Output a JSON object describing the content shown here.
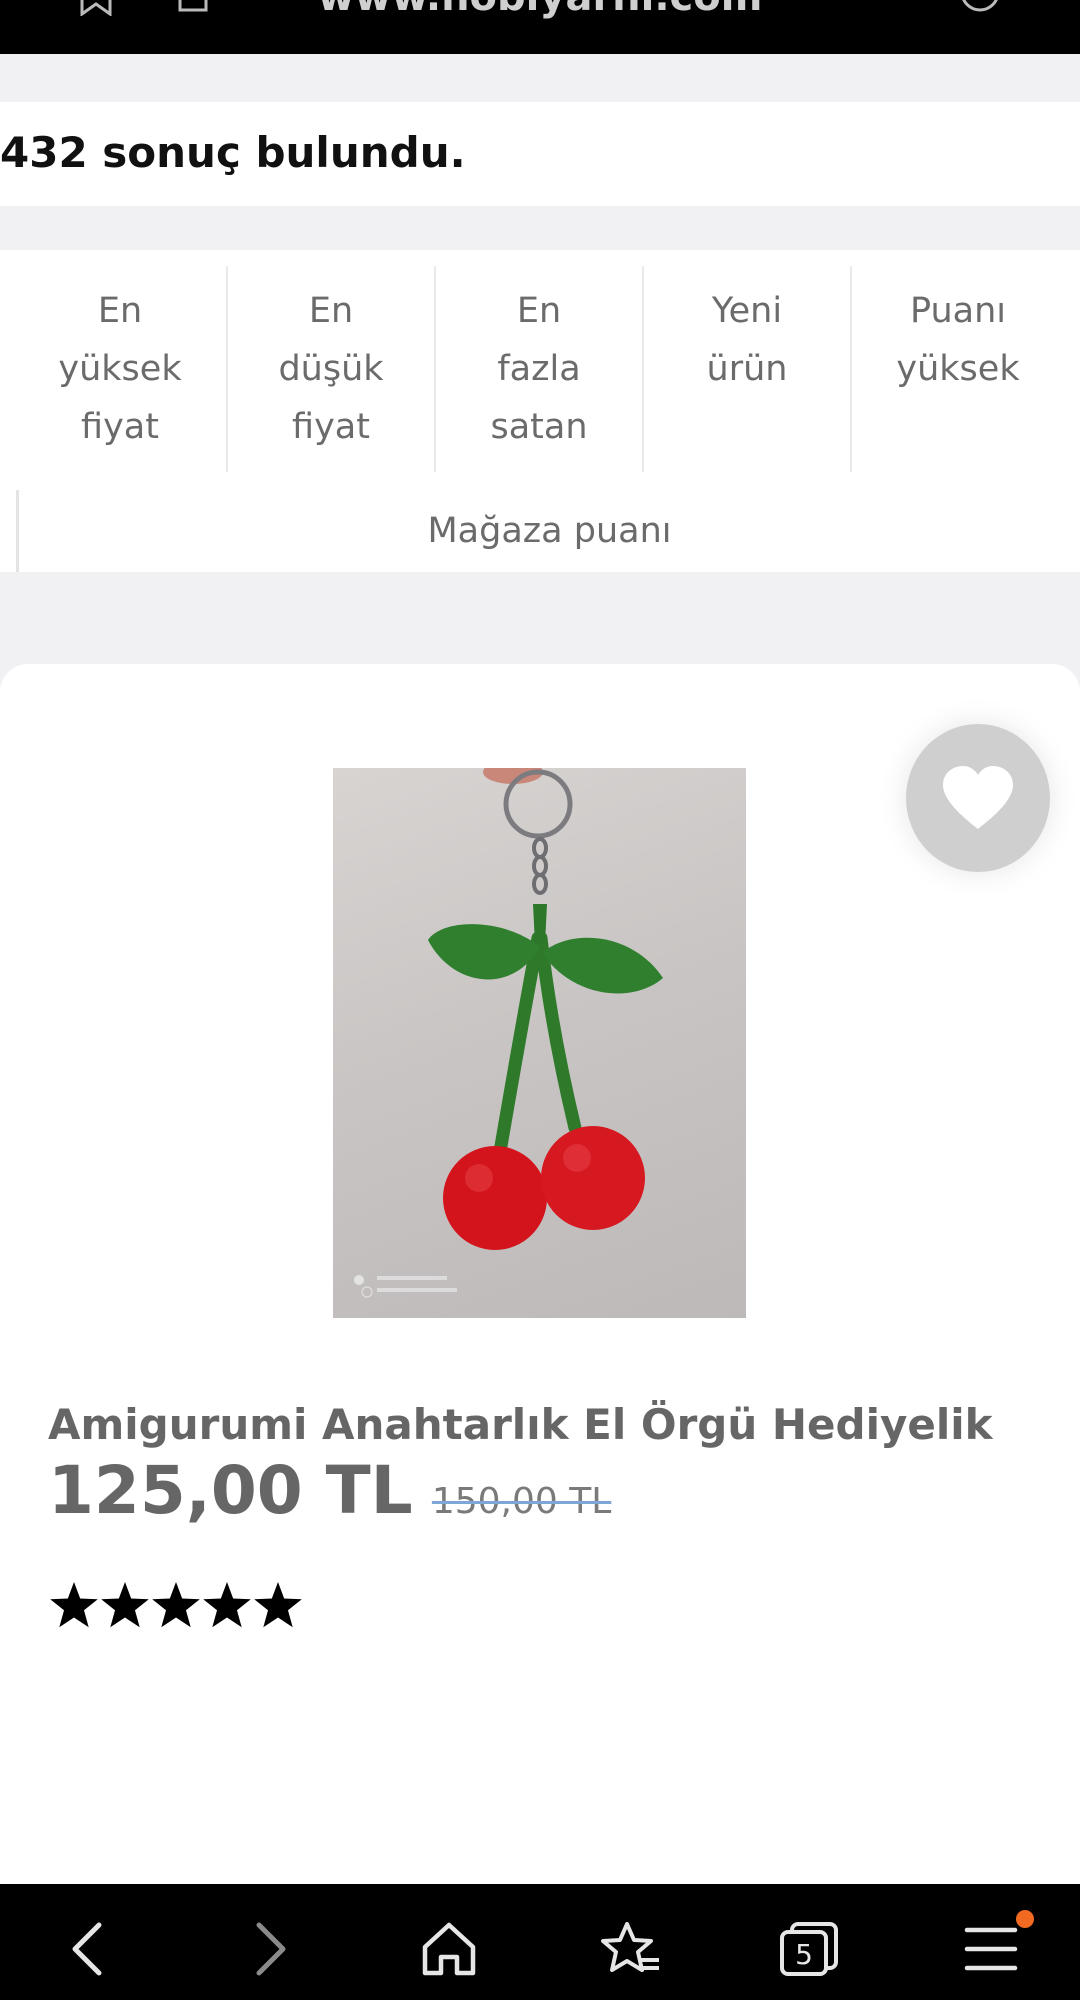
{
  "browser": {
    "url": "www.hobiyarni.com"
  },
  "results": {
    "count_text": "432 sonuç bulundu."
  },
  "sort": {
    "options": [
      {
        "label": "En\nyüksek\nfiyat"
      },
      {
        "label": "En\ndüşük\nfiyat"
      },
      {
        "label": "En\nfazla\nsatan"
      },
      {
        "label": "Yeni\nürün"
      },
      {
        "label": "Puanı\nyüksek"
      }
    ],
    "store_rating_label": "Mağaza puanı"
  },
  "product": {
    "title": "Amigurumi Anahtarlık El Örgü Hediyelik",
    "price": "125,00 TL",
    "old_price": "150,00 TL",
    "rating_stars": 5,
    "favorite_icon": "heart-icon"
  },
  "bottom_nav": {
    "tab_count": "5",
    "items": [
      "back-icon",
      "forward-icon",
      "home-icon",
      "bookmarks-icon",
      "tabs-icon",
      "menu-icon"
    ]
  },
  "colors": {
    "accent_dot": "#f26a21",
    "strike_line": "#7fa6d6"
  }
}
